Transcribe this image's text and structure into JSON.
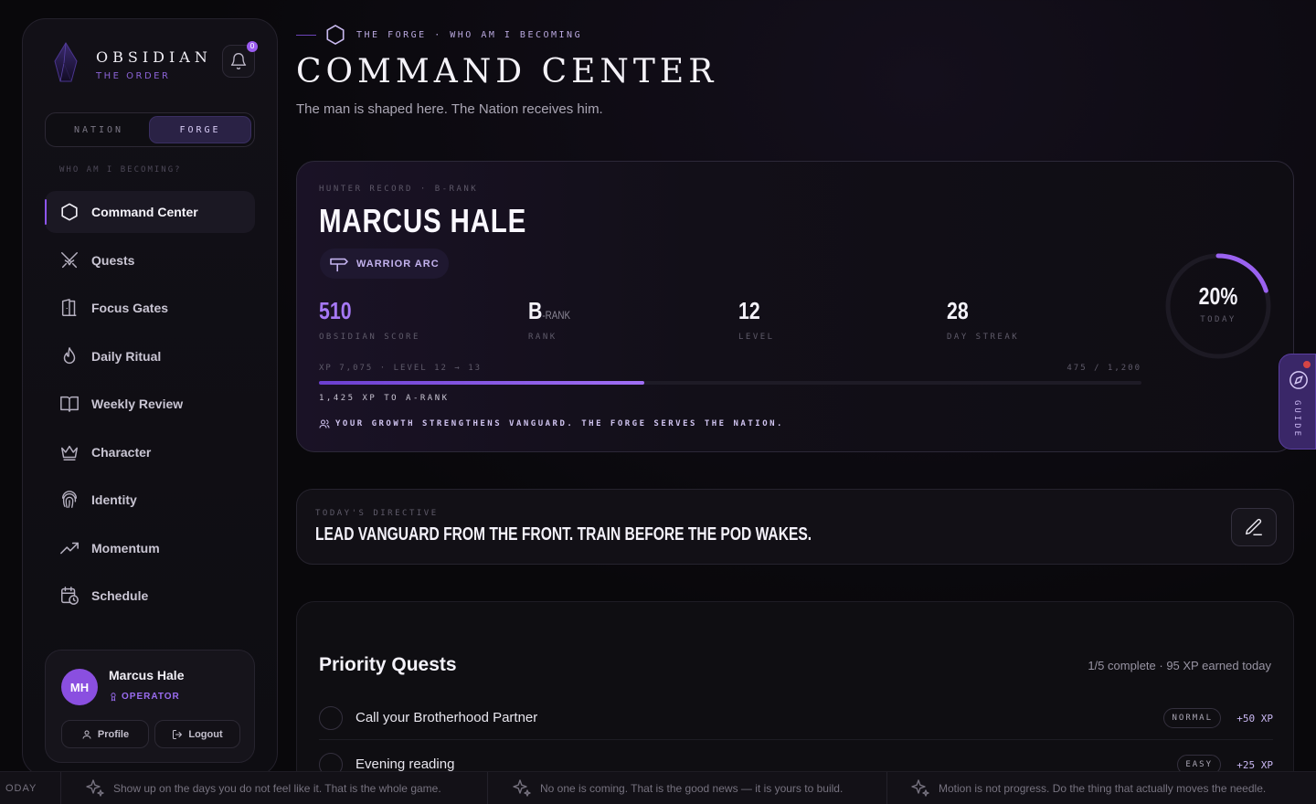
{
  "brand": {
    "name": "OBSIDIAN",
    "sub": "THE ORDER"
  },
  "notifications": {
    "count": "0"
  },
  "mode": {
    "options": [
      "NATION",
      "FORGE"
    ],
    "active": "FORGE"
  },
  "sidebar": {
    "section_label": "WHO AM I BECOMING?",
    "items": [
      {
        "label": "Command Center",
        "icon": "hexagon-icon",
        "active": true
      },
      {
        "label": "Quests",
        "icon": "crossed-swords-icon"
      },
      {
        "label": "Focus Gates",
        "icon": "gate-icon"
      },
      {
        "label": "Daily Ritual",
        "icon": "flame-icon"
      },
      {
        "label": "Weekly Review",
        "icon": "book-icon"
      },
      {
        "label": "Character",
        "icon": "crown-icon"
      },
      {
        "label": "Identity",
        "icon": "fingerprint-icon"
      },
      {
        "label": "Momentum",
        "icon": "trend-up-icon"
      },
      {
        "label": "Schedule",
        "icon": "calendar-clock-icon"
      }
    ]
  },
  "user": {
    "initials": "MH",
    "name": "Marcus Hale",
    "role": "OPERATOR",
    "profile_label": "Profile",
    "logout_label": "Logout"
  },
  "header": {
    "breadcrumb": "THE FORGE · WHO AM I BECOMING",
    "title": "COMMAND CENTER",
    "subtitle": "The man is shaped here. The Nation receives him."
  },
  "hunter": {
    "label": "HUNTER RECORD · B-RANK",
    "name": "MARCUS HALE",
    "arc": "WARRIOR ARC",
    "stats": [
      {
        "value": "510",
        "label": "OBSIDIAN SCORE",
        "accent": true
      },
      {
        "value": "B",
        "suffix": "-RANK",
        "label": "RANK"
      },
      {
        "value": "12",
        "label": "LEVEL"
      },
      {
        "value": "28",
        "label": "DAY STREAK"
      }
    ],
    "xp_left": "XP 7,075 · LEVEL 12 → 13",
    "xp_right": "475 / 1,200",
    "xp_progress": 0.396,
    "xp_to_next": "1,425 XP TO A-RANK",
    "growth_note": "YOUR GROWTH STRENGTHENS VANGUARD. THE FORGE SERVES THE NATION.",
    "today_value": "20%",
    "today_progress": 0.2,
    "today_label": "TODAY"
  },
  "guide": {
    "label": "GUIDE"
  },
  "directive": {
    "label": "TODAY'S DIRECTIVE",
    "text": "LEAD VANGUARD FROM THE FRONT. TRAIN BEFORE THE POD WAKES."
  },
  "quests": {
    "title": "Priority Quests",
    "meta": "1/5 complete · 95 XP earned today",
    "items": [
      {
        "name": "Call your Brotherhood Partner",
        "difficulty": "NORMAL",
        "xp": "+50 XP"
      },
      {
        "name": "Evening reading",
        "difficulty": "EASY",
        "xp": "+25 XP"
      }
    ]
  },
  "ticker": {
    "lead": "ODAY",
    "items": [
      "Show up on the days you do not feel like it. That is the whole game.",
      "No one is coming. That is the good news — it is yours to build.",
      "Motion is not progress. Do the thing that actually moves the needle."
    ]
  },
  "colors": {
    "accent": "#8e55f0",
    "background": "#09080b",
    "panel": "#121016"
  }
}
